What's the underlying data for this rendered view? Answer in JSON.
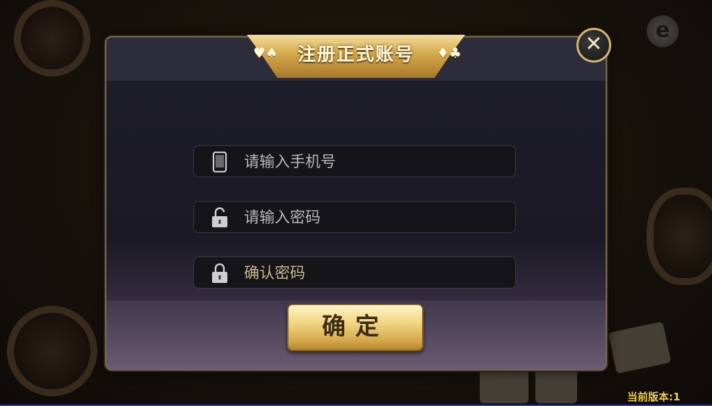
{
  "dialog": {
    "title": "注册正式账号",
    "suits_left": "♥♠",
    "suits_right": "♦♣",
    "close_label": "✕"
  },
  "form": {
    "phone_placeholder": "请输入手机号",
    "password_placeholder": "请输入密码",
    "confirm_password_placeholder": "确认密码",
    "submit_label": "确定"
  },
  "footer": {
    "version": "当前版本:1"
  },
  "brand": {
    "logo_letter": "e"
  },
  "colors": {
    "gold": "#d4a84a",
    "version_yellow": "#f2d24a",
    "dialog_bg": "#1f1e2c"
  }
}
